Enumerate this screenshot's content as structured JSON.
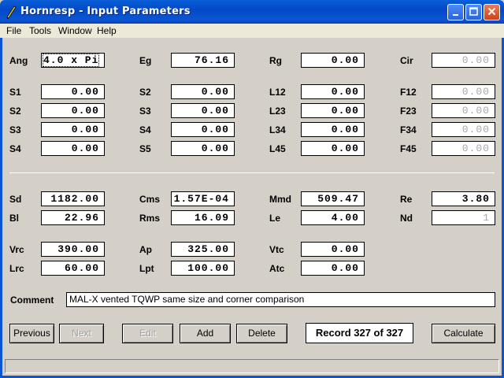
{
  "window": {
    "title": "Hornresp - Input Parameters"
  },
  "menu": {
    "file": "File",
    "tools": "Tools",
    "window": "Window",
    "help": "Help"
  },
  "rows": {
    "r1": [
      {
        "label": "Ang",
        "value": "4.0 x Pi",
        "state": "focus"
      },
      {
        "label": "Eg",
        "value": "76.16"
      },
      {
        "label": "Rg",
        "value": "0.00"
      },
      {
        "label": "Cir",
        "value": "0.00",
        "state": "dim"
      }
    ],
    "r2": [
      {
        "label": "S1",
        "value": "0.00"
      },
      {
        "label": "S2",
        "value": "0.00"
      },
      {
        "label": "L12",
        "value": "0.00"
      },
      {
        "label": "F12",
        "value": "0.00",
        "state": "dim"
      }
    ],
    "r3": [
      {
        "label": "S2",
        "value": "0.00"
      },
      {
        "label": "S3",
        "value": "0.00"
      },
      {
        "label": "L23",
        "value": "0.00"
      },
      {
        "label": "F23",
        "value": "0.00",
        "state": "dim"
      }
    ],
    "r4": [
      {
        "label": "S3",
        "value": "0.00"
      },
      {
        "label": "S4",
        "value": "0.00"
      },
      {
        "label": "L34",
        "value": "0.00"
      },
      {
        "label": "F34",
        "value": "0.00",
        "state": "dim"
      }
    ],
    "r5": [
      {
        "label": "S4",
        "value": "0.00"
      },
      {
        "label": "S5",
        "value": "0.00"
      },
      {
        "label": "L45",
        "value": "0.00"
      },
      {
        "label": "F45",
        "value": "0.00",
        "state": "dim"
      }
    ],
    "r6": [
      {
        "label": "Sd",
        "value": "1182.00"
      },
      {
        "label": "Cms",
        "value": "1.57E-04"
      },
      {
        "label": "Mmd",
        "value": "509.47"
      },
      {
        "label": "Re",
        "value": "3.80"
      }
    ],
    "r7": [
      {
        "label": "Bl",
        "value": "22.96"
      },
      {
        "label": "Rms",
        "value": "16.09"
      },
      {
        "label": "Le",
        "value": "4.00"
      },
      {
        "label": "Nd",
        "value": "1",
        "state": "dim"
      }
    ],
    "r8": [
      {
        "label": "Vrc",
        "value": "390.00"
      },
      {
        "label": "Ap",
        "value": "325.00"
      },
      {
        "label": "Vtc",
        "value": "0.00"
      }
    ],
    "r9": [
      {
        "label": "Lrc",
        "value": "60.00"
      },
      {
        "label": "Lpt",
        "value": "100.00"
      },
      {
        "label": "Atc",
        "value": "0.00"
      }
    ]
  },
  "comment": {
    "label": "Comment",
    "value": "MAL-X vented TQWP same size and corner comparison"
  },
  "buttons": {
    "previous": "Previous",
    "next": "Next",
    "edit": "Edit",
    "add": "Add",
    "delete": "Delete",
    "calculate": "Calculate"
  },
  "record": "Record 327 of 327",
  "colors": {
    "titlebar": "#0b55d4",
    "face": "#d4d0c8",
    "dim_text": "#a8a8a8"
  }
}
